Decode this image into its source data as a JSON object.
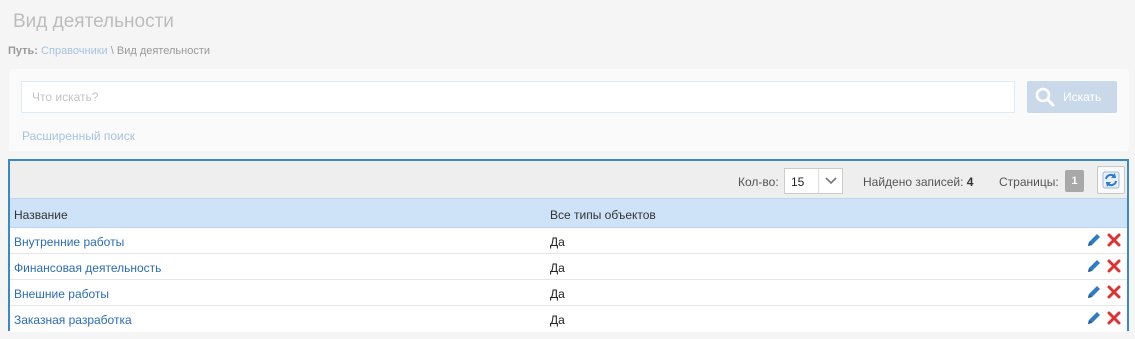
{
  "page": {
    "title": "Вид деятельности"
  },
  "breadcrumb": {
    "label": "Путь:",
    "link": "Справочники",
    "separator": " \\ ",
    "current": "Вид деятельности"
  },
  "search": {
    "placeholder": "Что искать?",
    "value": "",
    "button_label": "Искать",
    "advanced_link": "Расширенный поиск"
  },
  "toolbar": {
    "count_label": "Кол-во:",
    "count_value": "15",
    "found_label": "Найдено записей:",
    "found_value": "4",
    "pages_label": "Страницы:",
    "current_page": "1"
  },
  "table": {
    "columns": [
      "Название",
      "Все типы объектов"
    ],
    "rows": [
      {
        "name": "Внутренние работы",
        "all_types": "Да"
      },
      {
        "name": "Финансовая деятельность",
        "all_types": "Да"
      },
      {
        "name": "Внешние работы",
        "all_types": "Да"
      },
      {
        "name": "Заказная разработка",
        "all_types": "Да"
      }
    ]
  },
  "icons": {
    "search": "magnifier-icon",
    "refresh": "refresh-icon",
    "edit": "pencil-icon",
    "delete": "cross-icon",
    "dropdown": "chevron-down-icon"
  },
  "colors": {
    "accent": "#3c88c4",
    "link": "#2b6cb3",
    "header_bg": "#cfe3f8",
    "delete": "#e03131",
    "edit": "#2f7bc4"
  }
}
